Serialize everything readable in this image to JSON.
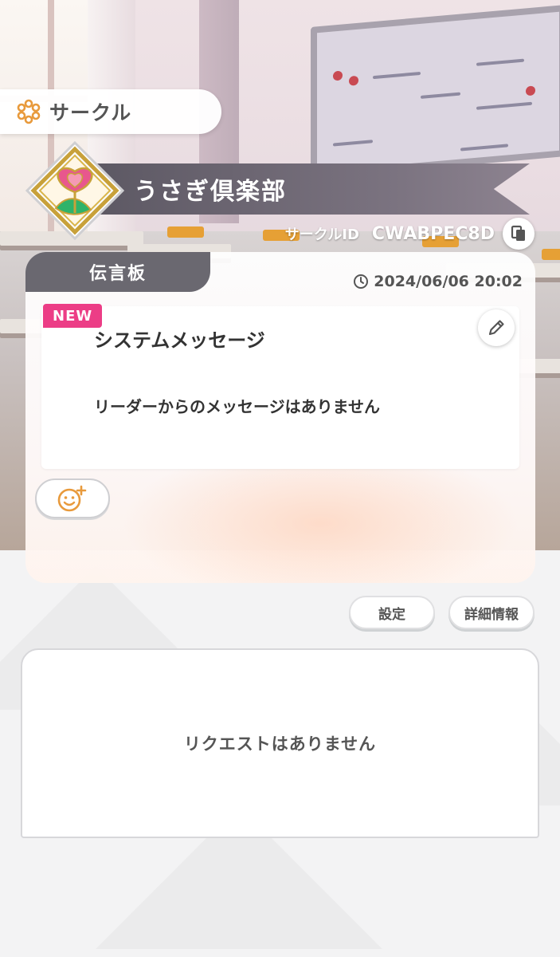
{
  "header": {
    "title": "サークル"
  },
  "circle": {
    "name": "うさぎ倶楽部",
    "id_label": "サークルID",
    "id_value": "CWABPEC8D"
  },
  "board": {
    "tab_label": "伝言板",
    "timestamp": "2024/06/06 20:02",
    "message": {
      "badge": "NEW",
      "title": "システムメッセージ",
      "body": "リーダーからのメッセージはありません"
    }
  },
  "buttons": {
    "settings_label": "設定",
    "details_label": "詳細情報"
  },
  "requests": {
    "empty_text": "リクエストはありません"
  },
  "icons": {
    "header": "flower-icon",
    "copy": "copy-icon",
    "clock": "clock-icon",
    "edit": "pencil-icon",
    "reaction": "smiley-plus-icon",
    "emblem": "circle-emblem-flower"
  },
  "colors": {
    "accent_orange": "#e89a3c",
    "new_badge": "#ec3d86",
    "banner": "#6a6870"
  }
}
